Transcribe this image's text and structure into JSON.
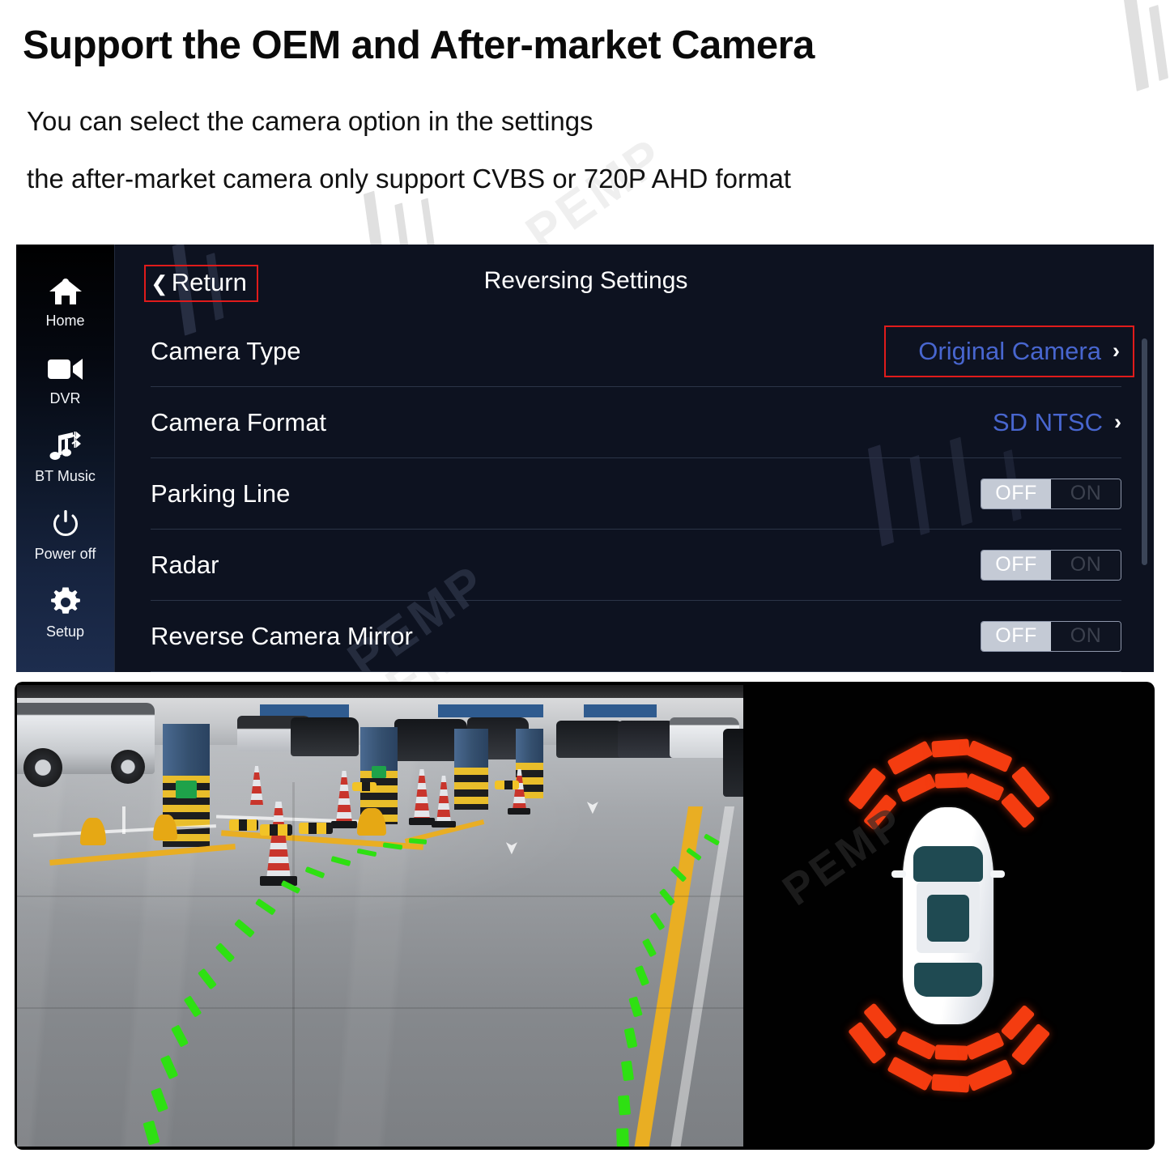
{
  "page": {
    "title": "Support the OEM and After-market Camera",
    "subtitle_line1": "You can select the camera option in the settings",
    "subtitle_line2": "the after-market camera only support CVBS or 720P AHD format",
    "watermark_text": "PEMP"
  },
  "head_unit": {
    "screen_title": "Reversing Settings",
    "return_label": "Return",
    "return_chevron": "chevron-left-icon",
    "highlight_color": "#e01b1b",
    "value_color": "#4866cf",
    "sidebar": {
      "items": [
        {
          "label": "Home",
          "icon": "home-icon"
        },
        {
          "label": "DVR",
          "icon": "video-camera-icon"
        },
        {
          "label": "BT Music",
          "icon": "music-bluetooth-icon"
        },
        {
          "label": "Power off",
          "icon": "power-icon"
        },
        {
          "label": "Setup",
          "icon": "gear-icon"
        }
      ]
    },
    "rows": [
      {
        "label": "Camera Type",
        "type": "value",
        "value": "Original Camera",
        "arrow": "›",
        "highlighted": true
      },
      {
        "label": "Camera Format",
        "type": "value",
        "value": "SD NTSC",
        "arrow": "›",
        "highlighted": false
      },
      {
        "label": "Parking Line",
        "type": "toggle",
        "off_label": "OFF",
        "on_label": "ON",
        "state": "OFF"
      },
      {
        "label": "Radar",
        "type": "toggle",
        "off_label": "OFF",
        "on_label": "ON",
        "state": "OFF"
      },
      {
        "label": "Reverse Camera Mirror",
        "type": "toggle",
        "off_label": "OFF",
        "on_label": "ON",
        "state": "OFF"
      }
    ]
  },
  "media": {
    "camera_view": {
      "name": "rear-view-camera-feed",
      "description": "Underground parking garage rear camera view with green dynamic parking guide lines",
      "guide_line_color": "#2ee012",
      "lane_line_color": "#e9ae23"
    },
    "radar_view": {
      "name": "parking-radar-display",
      "description": "Top-down car icon with front and rear red proximity arc segments",
      "arc_color": "#f43c10",
      "car_color": "#ffffff",
      "front_arc_segments": 3,
      "rear_arc_segments": 3
    }
  }
}
